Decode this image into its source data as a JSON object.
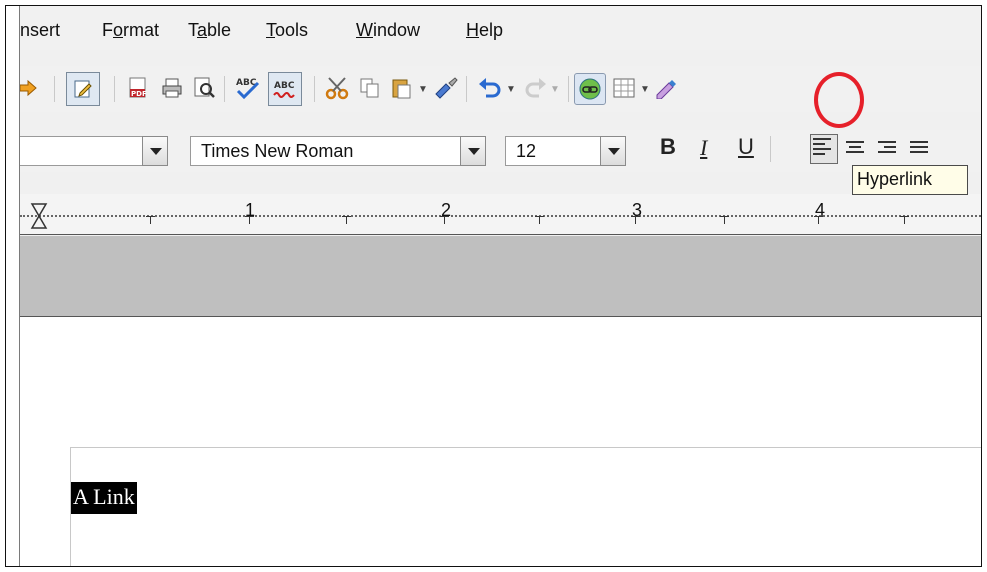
{
  "menu": {
    "insert": {
      "head": "",
      "ul": "",
      "rest": "nsert"
    },
    "format": {
      "head": "F",
      "ul": "o",
      "rest": "rmat"
    },
    "table": {
      "head": "T",
      "ul": "a",
      "rest": "ble"
    },
    "tools": {
      "head": "",
      "ul": "T",
      "rest": "ools"
    },
    "window": {
      "head": "",
      "ul": "W",
      "rest": "indow"
    },
    "help": {
      "head": "",
      "ul": "H",
      "rest": "elp"
    }
  },
  "spell": {
    "abc1": "ABC",
    "abc2": "ABC",
    "pdf": "PDF"
  },
  "formatting": {
    "font_name": "Times New Roman",
    "font_size": "12",
    "bold": "B",
    "italic": "I",
    "underline": "U"
  },
  "tooltip": {
    "text": "Hyperlink"
  },
  "ruler": {
    "marks": [
      "1",
      "2",
      "3",
      "4"
    ]
  },
  "document": {
    "selected_text": "A Link"
  },
  "colors": {
    "highlight_circle": "#e6202a",
    "selection_bg": "#000000"
  }
}
